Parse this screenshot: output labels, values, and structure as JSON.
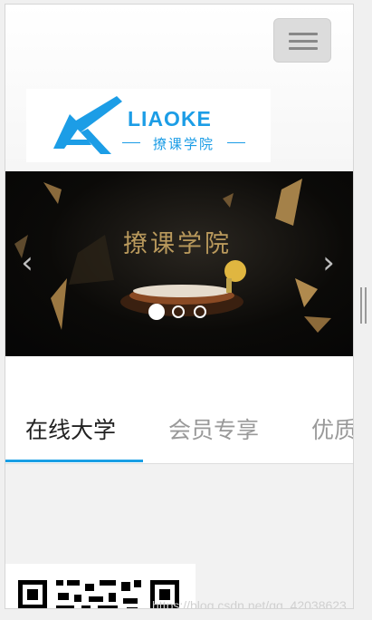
{
  "navbar": {
    "logo_wordmark": "LIAOKE",
    "logo_subtitle": "撩课学院",
    "toggle_icon": "hamburger-icon"
  },
  "carousel": {
    "title": "撩课学院",
    "prev_arrow": "‹",
    "next_arrow": "›",
    "indicator_count": 3,
    "active_index": 0
  },
  "tabs": [
    {
      "label": "在线大学",
      "active": true
    },
    {
      "label": "会员专享",
      "active": false
    },
    {
      "label": "优质",
      "active": false
    }
  ],
  "watermark": "https://blog.csdn.net/qq_42038623",
  "colors": {
    "accent": "#1a9fe5",
    "tab_active": "#222222",
    "tab_inactive": "#999999"
  }
}
